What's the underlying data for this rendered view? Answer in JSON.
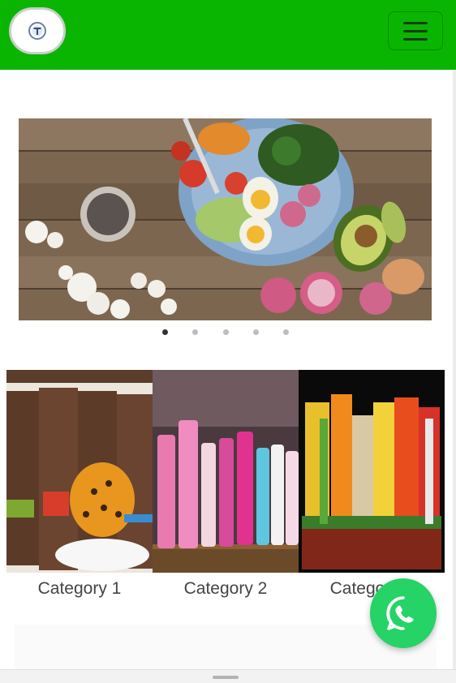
{
  "header": {
    "background": "#09b500",
    "logo_icon": "brand-logo-icon",
    "menu_icon": "hamburger-menu-icon"
  },
  "carousel": {
    "slide_count": 5,
    "active_index": 0,
    "image": "food-bowl-salad-photo"
  },
  "categories": [
    {
      "label": "Category 1",
      "image": "packaged-cookies-photo"
    },
    {
      "label": "Category 2",
      "image": "shampoo-bottles-photo"
    },
    {
      "label": "Category 3",
      "image": "snacks-drinks-photo"
    }
  ],
  "whatsapp": {
    "icon": "whatsapp-icon",
    "color": "#25d366"
  }
}
